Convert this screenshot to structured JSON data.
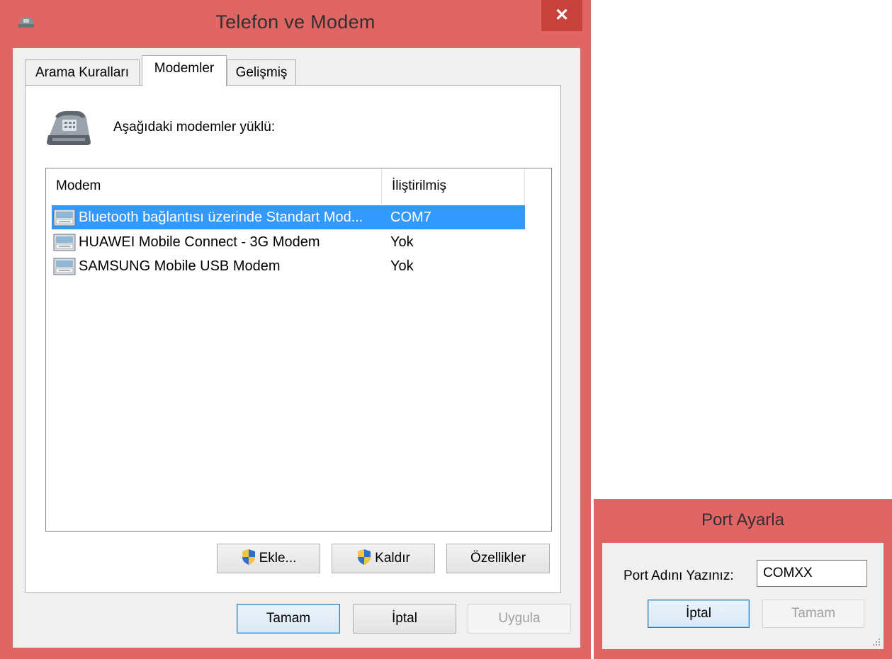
{
  "main_window": {
    "title": "Telefon ve Modem",
    "close_glyph": "✕",
    "tabs": [
      {
        "label": "Arama Kuralları",
        "active": false
      },
      {
        "label": "Modemler",
        "active": true
      },
      {
        "label": "Gelişmiş",
        "active": false
      }
    ],
    "heading": "Aşağıdaki modemler yüklü:",
    "list": {
      "columns": [
        "Modem",
        "İliştirilmiş"
      ],
      "rows": [
        {
          "name": "Bluetooth bağlantısı üzerinde Standart Mod...",
          "port": "COM7",
          "selected": true
        },
        {
          "name": "HUAWEI Mobile Connect - 3G Modem",
          "port": "Yok",
          "selected": false
        },
        {
          "name": "SAMSUNG Mobile USB Modem",
          "port": "Yok",
          "selected": false
        }
      ]
    },
    "buttons": {
      "add": "Ekle...",
      "remove": "Kaldır",
      "properties": "Özellikler",
      "ok": "Tamam",
      "cancel": "İptal",
      "apply": "Uygula"
    }
  },
  "port_window": {
    "title": "Port Ayarla",
    "label": "Port Adını Yazınız:",
    "input_value": "COMXX",
    "buttons": {
      "cancel": "İptal",
      "ok": "Tamam"
    }
  },
  "colors": {
    "frame": "#e06666",
    "selection": "#3399ff",
    "close": "#c8413a"
  },
  "icons": [
    "phone-modem-icon",
    "modem-icon",
    "uac-shield-icon",
    "close-icon",
    "resize-grip-icon"
  ]
}
